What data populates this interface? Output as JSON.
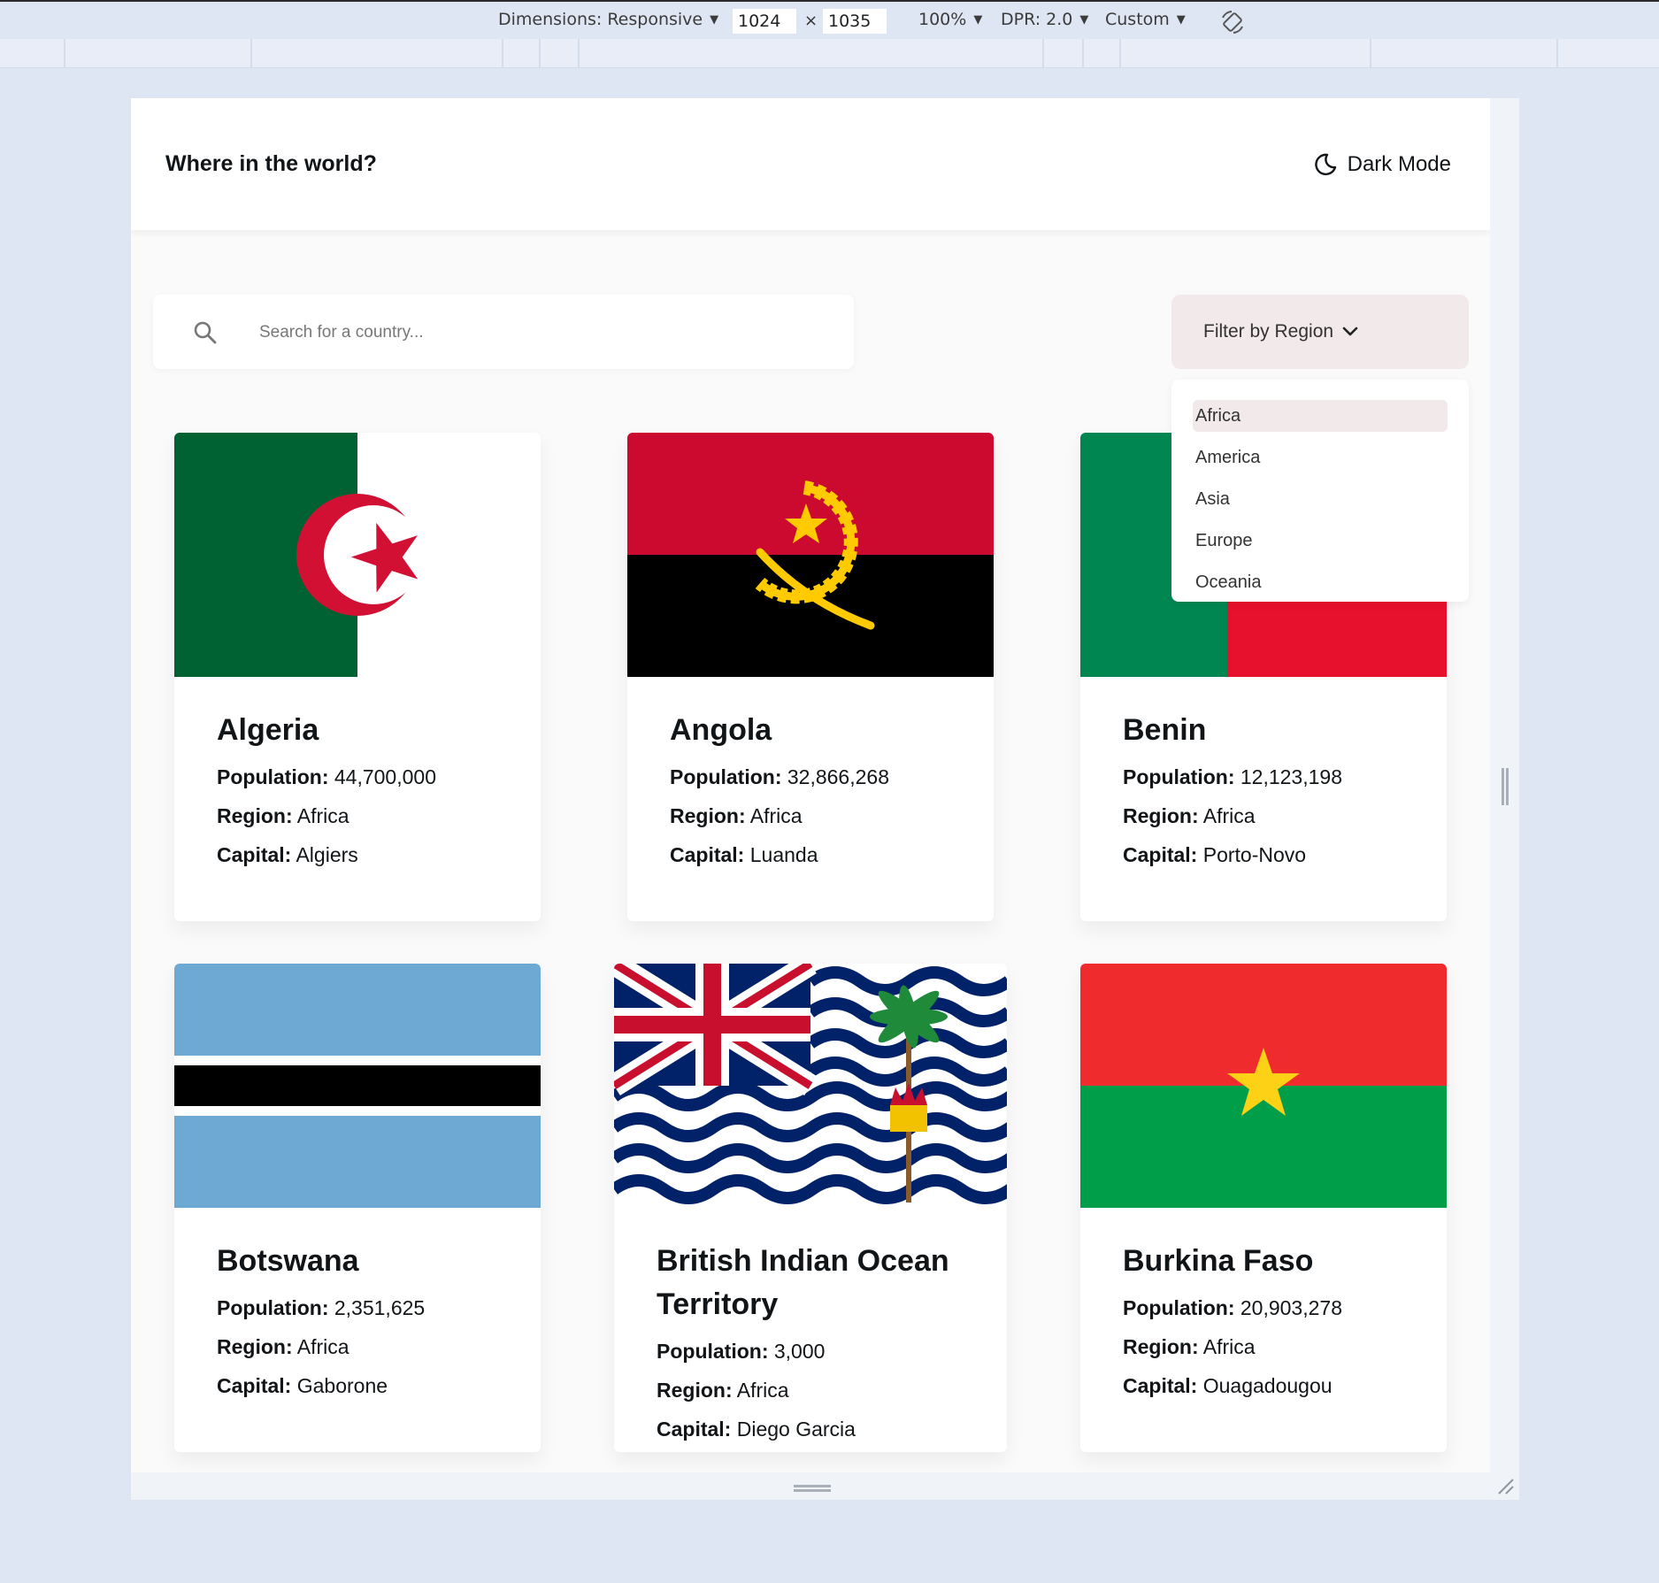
{
  "devtools": {
    "dimensions_label": "Dimensions: Responsive",
    "width_value": "1024",
    "height_value": "1035",
    "times": "×",
    "zoom_label": "100%",
    "dpr_label": "DPR: 2.0",
    "throttle_label": "Custom"
  },
  "header": {
    "title": "Where in the world?",
    "dark_mode_label": "Dark Mode"
  },
  "search": {
    "placeholder": "Search for a country..."
  },
  "filter": {
    "label": "Filter by Region",
    "options": [
      "Africa",
      "America",
      "Asia",
      "Europe",
      "Oceania"
    ],
    "highlighted": "Africa"
  },
  "labels": {
    "population": "Population:",
    "region": "Region:",
    "capital": "Capital:"
  },
  "countries": [
    {
      "name": "Algeria",
      "population": "44,700,000",
      "region": "Africa",
      "capital": "Algiers",
      "flag_icon": "algeria-flag"
    },
    {
      "name": "Angola",
      "population": "32,866,268",
      "region": "Africa",
      "capital": "Luanda",
      "flag_icon": "angola-flag"
    },
    {
      "name": "Benin",
      "population": "12,123,198",
      "region": "Africa",
      "capital": "Porto-Novo",
      "flag_icon": "benin-flag"
    },
    {
      "name": "Botswana",
      "population": "2,351,625",
      "region": "Africa",
      "capital": "Gaborone",
      "flag_icon": "botswana-flag"
    },
    {
      "name": "British Indian Ocean Territory",
      "population": "3,000",
      "region": "Africa",
      "capital": "Diego Garcia",
      "flag_icon": "biot-flag"
    },
    {
      "name": "Burkina Faso",
      "population": "20,903,278",
      "region": "Africa",
      "capital": "Ouagadougou",
      "flag_icon": "burkina-faso-flag"
    }
  ],
  "colors": {
    "page_bg": "#fafafa",
    "devtools_bg": "#dfe6f3",
    "filter_bg": "#f1e9ea"
  }
}
